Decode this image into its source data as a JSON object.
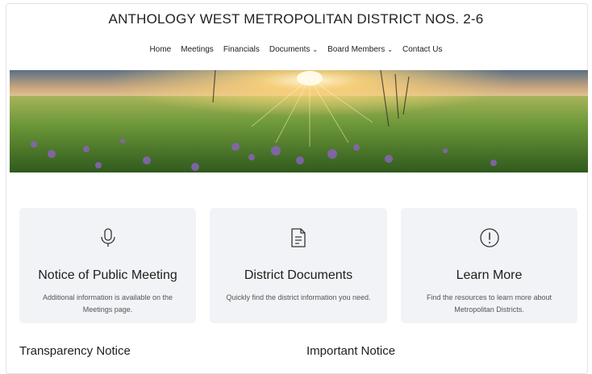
{
  "header": {
    "site_title": "ANTHOLOGY WEST METROPOLITAN DISTRICT NOS. 2-6"
  },
  "nav": {
    "items": [
      {
        "label": "Home",
        "has_dropdown": false
      },
      {
        "label": "Meetings",
        "has_dropdown": false
      },
      {
        "label": "Financials",
        "has_dropdown": false
      },
      {
        "label": "Documents",
        "has_dropdown": true
      },
      {
        "label": "Board Members",
        "has_dropdown": true
      },
      {
        "label": "Contact Us",
        "has_dropdown": false
      }
    ],
    "dropdown_glyph": "⌄"
  },
  "hero": {
    "icon": "prairie-sunset-image"
  },
  "cards": [
    {
      "icon": "microphone-icon",
      "title": "Notice of Public Meeting",
      "description": "Additional information is available on the Meetings page."
    },
    {
      "icon": "document-icon",
      "title": "District Documents",
      "description": "Quickly find the district information you need."
    },
    {
      "icon": "info-circle-icon",
      "title": "Learn More",
      "description": "Find the resources to learn more about Metropolitan Districts."
    }
  ],
  "sections": {
    "transparency_heading": "Transparency Notice",
    "important_heading": "Important Notice"
  },
  "colors": {
    "card_background": "#f2f3f6",
    "text_primary": "#1e1e1e",
    "text_secondary": "#555555"
  }
}
